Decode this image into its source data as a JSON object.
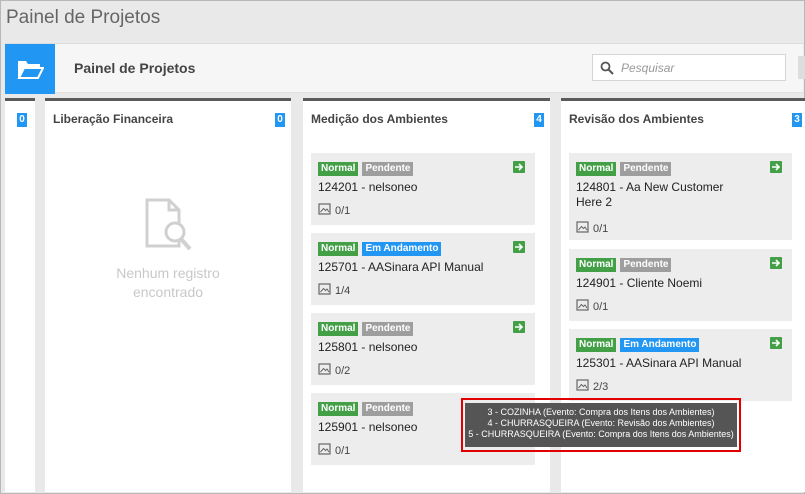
{
  "window": {
    "title": "Painel de Projetos"
  },
  "header": {
    "icon": "folder-open-icon",
    "title": "Painel de Projetos",
    "search": {
      "placeholder": "Pesquisar",
      "value": "",
      "icon": "search-icon"
    }
  },
  "colors": {
    "accent": "#2196f3",
    "normal": "#43a047",
    "pendente": "#9e9e9e",
    "andamento": "#2196f3",
    "tooltip": "#555555",
    "highlight": "#e00000"
  },
  "columns": [
    {
      "title": "",
      "count": "0"
    },
    {
      "title": "Liberação Financeira",
      "count": "0",
      "empty_icon": "document-search-icon",
      "empty_line1": "Nenhum registro",
      "empty_line2": "encontrado"
    },
    {
      "title": "Medição dos Ambientes",
      "count": "4",
      "cards": [
        {
          "priority": "Normal",
          "status": "Pendente",
          "title": "124201 - nelsoneo",
          "progress": "0/1"
        },
        {
          "priority": "Normal",
          "status": "Em Andamento",
          "title": "125701 - AASinara API Manual",
          "progress": "1/4"
        },
        {
          "priority": "Normal",
          "status": "Pendente",
          "title": "125801 - nelsoneo",
          "progress": "0/2"
        },
        {
          "priority": "Normal",
          "status": "Pendente",
          "title": "125901 - nelsoneo",
          "progress": "0/1"
        }
      ]
    },
    {
      "title": "Revisão dos Ambientes",
      "count": "3",
      "cards": [
        {
          "priority": "Normal",
          "status": "Pendente",
          "title": "124801 - Aa New Customer Here 2",
          "progress": "0/1"
        },
        {
          "priority": "Normal",
          "status": "Pendente",
          "title": "124901 - Cliente Noemi",
          "progress": "0/1"
        },
        {
          "priority": "Normal",
          "status": "Em Andamento",
          "title": "125301 - AASinara API Manual",
          "progress": "2/3"
        }
      ]
    }
  ],
  "tooltip": {
    "lines": [
      "3 - COZINHA (Evento: Compra dos Itens dos Ambientes)",
      "4 - CHURRASQUEIRA (Evento: Revisão dos Ambientes)",
      "5 - CHURRASQUEIRA (Evento: Compra dos Itens dos Ambientes)"
    ]
  }
}
